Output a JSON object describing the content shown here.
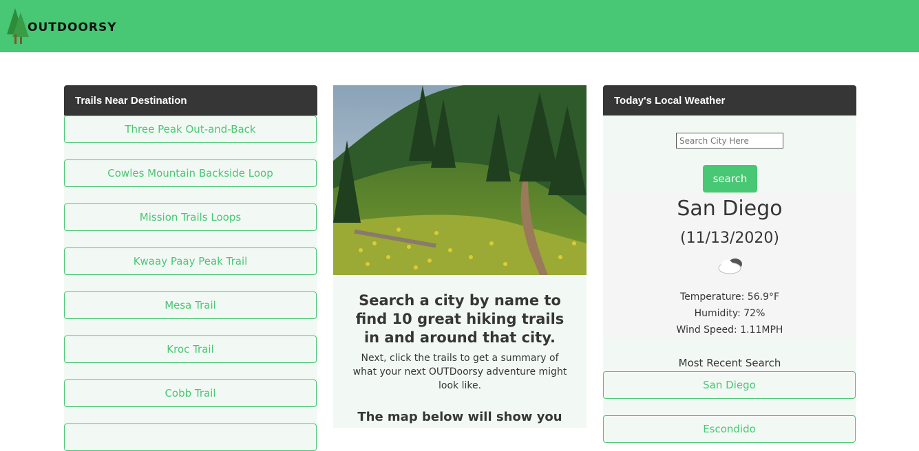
{
  "brand": {
    "name": "OUTDOORSY"
  },
  "trails": {
    "header": "Trails Near Destination",
    "items": [
      "Three Peak Out-and-Back",
      "Cowles Mountain Backside Loop",
      "Mission Trails Loops",
      "Kwaay Paay Peak Trail",
      "Mesa Trail",
      "Kroc Trail",
      "Cobb Trail",
      ""
    ]
  },
  "intro": {
    "heading": "Search a city by name to find 10 great hiking trails in and around that city.",
    "body": "Next, click the trails to get a summary of what your next OUTDoorsy adventure might look like.",
    "map_heading": "The map below will show you"
  },
  "weather": {
    "header": "Today's Local Weather",
    "search_placeholder": "Search City Here",
    "search_label": "search",
    "city": "San Diego",
    "date": "(11/13/2020)",
    "icon": "cloud-icon",
    "temperature": "Temperature: 56.9°F",
    "humidity": "Humidity: 72%",
    "wind": "Wind Speed: 1.11MPH",
    "recent_label": "Most Recent Search",
    "recent": [
      "San Diego",
      "Escondido"
    ]
  },
  "colors": {
    "accent": "#48c774",
    "header_dark": "#363636",
    "panel_bg": "#f2f9f4"
  }
}
